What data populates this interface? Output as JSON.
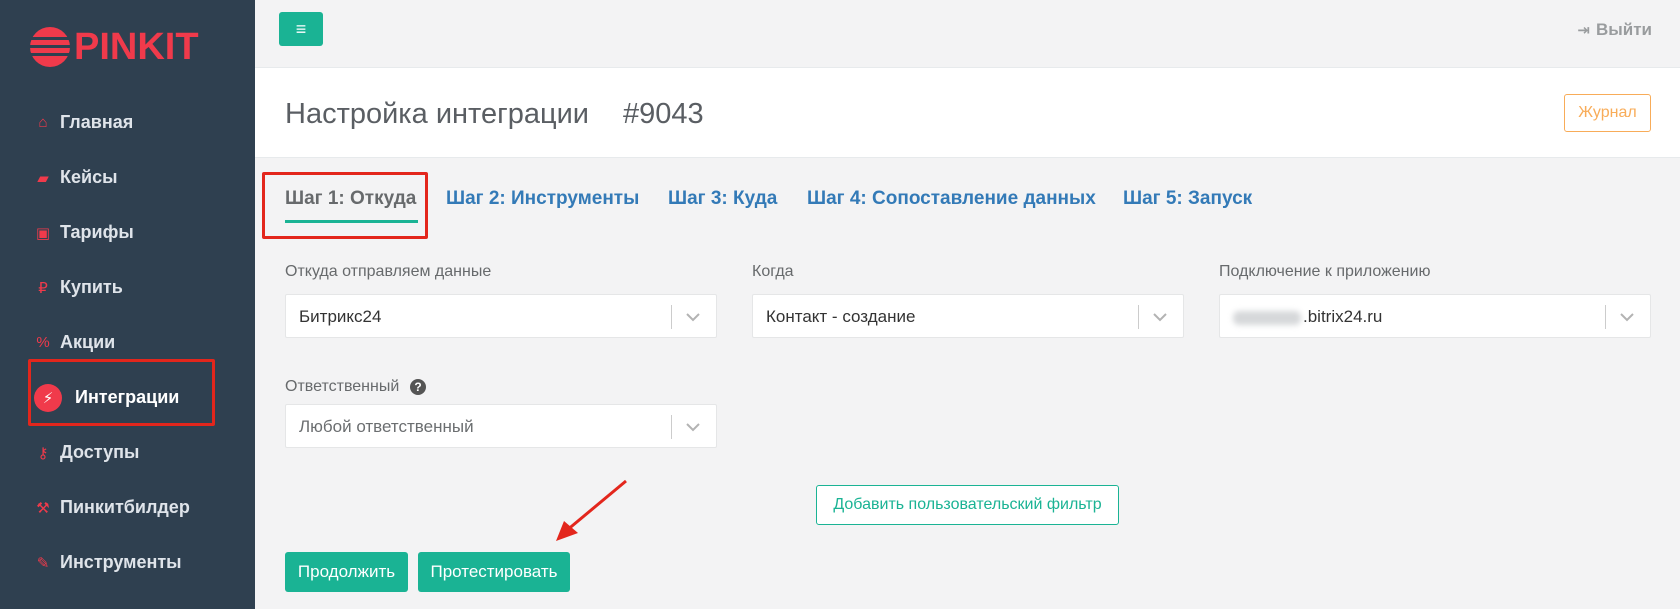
{
  "brand": {
    "name": "PINKIT",
    "accent": "#f03a4b",
    "green": "#1ab394"
  },
  "sidebar": {
    "items": [
      {
        "icon": "home-icon",
        "glyph": "⌂",
        "label": "Главная"
      },
      {
        "icon": "briefcase-icon",
        "glyph": "▰",
        "label": "Кейсы"
      },
      {
        "icon": "tariff-icon",
        "glyph": "▣",
        "label": "Тарифы"
      },
      {
        "icon": "ruble-icon",
        "glyph": "₽",
        "label": "Купить"
      },
      {
        "icon": "percent-icon",
        "glyph": "%",
        "label": "Акции"
      },
      {
        "icon": "plug-icon",
        "glyph": "⚡",
        "label": "Интеграции"
      },
      {
        "icon": "key-icon",
        "glyph": "⚷",
        "label": "Доступы"
      },
      {
        "icon": "hammer-icon",
        "glyph": "⚒",
        "label": "Пинкитбилдер"
      },
      {
        "icon": "wrench-icon",
        "glyph": "✎",
        "label": "Инструменты"
      }
    ]
  },
  "topbar": {
    "menu_glyph": "≡",
    "logout_label": "Выйти",
    "logout_glyph": "⇥"
  },
  "header": {
    "title": "Настройка интеграции",
    "id": "#9043",
    "journal_label": "Журнал"
  },
  "tabs": [
    {
      "label": "Шаг 1: Откуда",
      "active": true
    },
    {
      "label": "Шаг 2: Инструменты",
      "active": false
    },
    {
      "label": "Шаг 3: Куда",
      "active": false
    },
    {
      "label": "Шаг 4: Сопоставление данных",
      "active": false
    },
    {
      "label": "Шаг 5: Запуск",
      "active": false
    }
  ],
  "form": {
    "source": {
      "label": "Откуда отправляем данные",
      "value": "Битрикс24"
    },
    "when": {
      "label": "Когда",
      "value": "Контакт - создание"
    },
    "connection": {
      "label": "Подключение к приложению",
      "value": ".bitrix24.ru"
    },
    "responsible": {
      "label": "Ответственный",
      "placeholder": "Любой ответственный",
      "help_glyph": "?"
    }
  },
  "buttons": {
    "add_filter": "Добавить пользовательский фильтр",
    "continue": "Продолжить",
    "test": "Протестировать"
  }
}
